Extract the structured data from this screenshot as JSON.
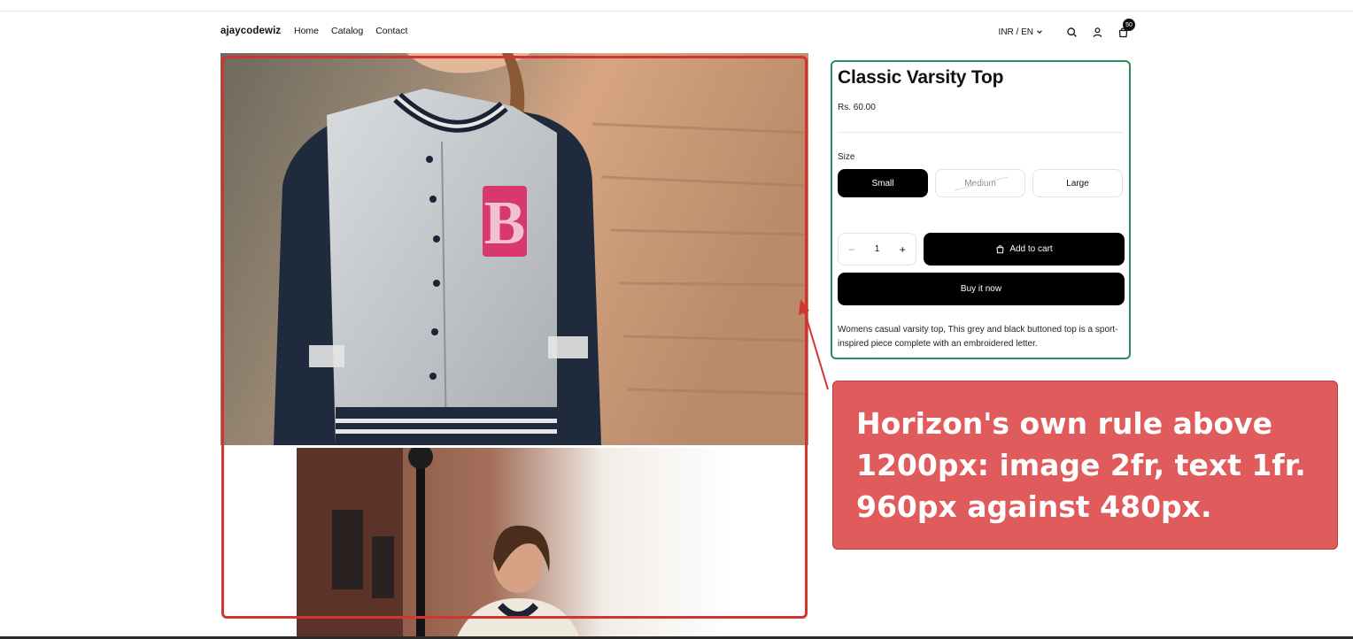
{
  "header": {
    "logo": "ajaycodewiz",
    "nav": [
      "Home",
      "Catalog",
      "Contact"
    ],
    "locale": "INR / EN",
    "cart_count": "50",
    "icons": [
      "search-icon",
      "account-icon",
      "cart-icon",
      "chevron-down-icon"
    ]
  },
  "product": {
    "title": "Classic Varsity Top",
    "price": "Rs. 60.00",
    "size_label": "Size",
    "sizes": [
      {
        "label": "Small",
        "state": "selected"
      },
      {
        "label": "Medium",
        "state": "unavailable"
      },
      {
        "label": "Large",
        "state": "available"
      }
    ],
    "quantity": {
      "minus": "−",
      "value": "1",
      "plus": "+"
    },
    "add_to_cart": "Add to cart",
    "buy_now": "Buy it now",
    "description": "Womens casual varsity top, This grey and black buttoned top is a sport-inspired piece complete with an embroidered letter."
  },
  "annotation": {
    "text": "Horizon's own rule above 1200px: image 2fr, text 1fr. 960px against 480px."
  },
  "colors": {
    "annotation_bg": "#e05c5c",
    "media_outline": "#d33432",
    "info_outline": "#2e8b57",
    "button_bg": "#000000"
  }
}
